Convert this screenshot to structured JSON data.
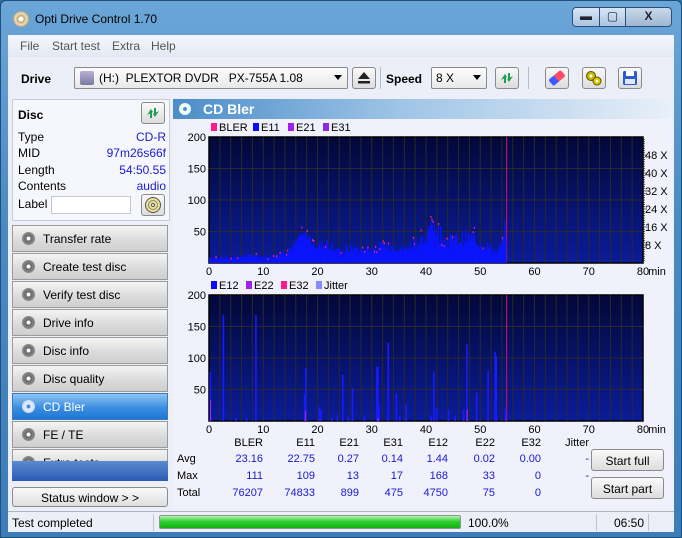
{
  "window": {
    "title": "Opti Drive Control 1.70",
    "min_glyph": "▬",
    "max_glyph": "▢",
    "close_glyph": "X"
  },
  "menu": [
    "File",
    "Start test",
    "Extra",
    "Help"
  ],
  "toolbar": {
    "drive_label": "Drive",
    "drive_value": "(H:)  PLEXTOR DVDR   PX-755A 1.08",
    "speed_label": "Speed",
    "speed_value": "8 X"
  },
  "disc": {
    "title": "Disc",
    "rows": [
      {
        "key": "Type",
        "value": "CD-R"
      },
      {
        "key": "MID",
        "value": "97m26s66f"
      },
      {
        "key": "Length",
        "value": "54:50.55"
      },
      {
        "key": "Contents",
        "value": "audio"
      }
    ],
    "label_key": "Label",
    "label_value": ""
  },
  "nav": [
    {
      "label": "Transfer rate",
      "active": false
    },
    {
      "label": "Create test disc",
      "active": false
    },
    {
      "label": "Verify test disc",
      "active": false
    },
    {
      "label": "Drive info",
      "active": false
    },
    {
      "label": "Disc info",
      "active": false
    },
    {
      "label": "Disc quality",
      "active": false
    },
    {
      "label": "CD Bler",
      "active": true
    },
    {
      "label": "FE / TE",
      "active": false
    },
    {
      "label": "Extra tests",
      "active": false
    }
  ],
  "status_window_button": "Status window > >",
  "panel": {
    "title": "CD Bler"
  },
  "chart_data": [
    {
      "type": "bar",
      "title": "",
      "legend": [
        {
          "name": "BLER",
          "color": "#ff1a8c"
        },
        {
          "name": "E11",
          "color": "#0a0aff"
        },
        {
          "name": "E21",
          "color": "#a020f0"
        },
        {
          "name": "E31",
          "color": "#8a2be2"
        }
      ],
      "legend_position": "top-left",
      "xlabel": "min",
      "xlim": [
        0,
        80
      ],
      "xticks": [
        0,
        10,
        20,
        30,
        40,
        50,
        60,
        70,
        80
      ],
      "ylim": [
        0,
        200
      ],
      "yticks": [
        50,
        100,
        150,
        200
      ],
      "y2ticks": [
        "8 X",
        "16 X",
        "24 X",
        "32 X",
        "40 X",
        "48 X"
      ],
      "y2lim": [
        0,
        56
      ],
      "grid": true,
      "disc_end_min": 54.85,
      "series_profile": {
        "name": "E11/BLER (approx. envelope)",
        "x": [
          0,
          2,
          4,
          6,
          8,
          10,
          12,
          14,
          16,
          17,
          18,
          19,
          20,
          22,
          24,
          26,
          28,
          30,
          32,
          34,
          36,
          38,
          40,
          41,
          42,
          44,
          46,
          48,
          50,
          52,
          53,
          54,
          54.8
        ],
        "values": [
          10,
          10,
          9,
          12,
          14,
          10,
          14,
          22,
          35,
          55,
          48,
          40,
          30,
          38,
          20,
          28,
          25,
          27,
          30,
          32,
          25,
          40,
          42,
          78,
          60,
          40,
          45,
          48,
          38,
          28,
          20,
          35,
          80
        ]
      }
    },
    {
      "type": "bar",
      "title": "",
      "legend": [
        {
          "name": "E12",
          "color": "#0a0aff"
        },
        {
          "name": "E22",
          "color": "#a020f0"
        },
        {
          "name": "E32",
          "color": "#ff1a8c"
        },
        {
          "name": "Jitter",
          "color": "#8888ff"
        }
      ],
      "legend_position": "top-left",
      "xlabel": "min",
      "xlim": [
        0,
        80
      ],
      "xticks": [
        0,
        10,
        20,
        30,
        40,
        50,
        60,
        70,
        80
      ],
      "ylim": [
        0,
        200
      ],
      "yticks": [
        50,
        100,
        150,
        200
      ],
      "grid": true,
      "disc_end_min": 54.85,
      "spikes": {
        "name": "E12",
        "x": [
          0.1,
          2.5,
          4.8,
          6.8,
          8.5,
          17.5,
          17.7,
          20.2,
          20.5,
          22.5,
          23.5,
          24.5,
          25.5,
          26.3,
          28.5,
          30.8,
          31.0,
          31.2,
          32.9,
          34.4,
          35.0,
          36.2,
          40.8,
          41.3,
          41.8,
          44.0,
          45.2,
          46.8,
          47.4,
          49.2,
          51.3,
          52.6,
          52.8,
          54.5
        ],
        "values": [
          78,
          168,
          5,
          5,
          168,
          42,
          84,
          22,
          18,
          6,
          10,
          73,
          8,
          52,
          8,
          86,
          86,
          25,
          124,
          44,
          8,
          26,
          8,
          78,
          20,
          18,
          8,
          18,
          122,
          45,
          80,
          110,
          103,
          20
        ]
      },
      "spikes_e22": {
        "name": "E22",
        "x": [
          0.1,
          17.6,
          31.0,
          47.4
        ],
        "values": [
          33,
          16,
          5,
          18
        ]
      }
    }
  ],
  "stats": {
    "columns": [
      "BLER",
      "E11",
      "E21",
      "E31",
      "E12",
      "E22",
      "E32",
      "Jitter"
    ],
    "rows": [
      {
        "label": "Avg",
        "values": [
          "23.16",
          "22.75",
          "0.27",
          "0.14",
          "1.44",
          "0.02",
          "0.00",
          "-"
        ]
      },
      {
        "label": "Max",
        "values": [
          "111",
          "109",
          "13",
          "17",
          "168",
          "33",
          "0",
          "-"
        ]
      },
      {
        "label": "Total",
        "values": [
          "76207",
          "74833",
          "899",
          "475",
          "4750",
          "75",
          "0",
          ""
        ]
      }
    ]
  },
  "buttons": {
    "start_full": "Start full",
    "start_part": "Start part"
  },
  "statusbar": {
    "text": "Test completed",
    "progress_percent": 100,
    "progress_text": "100.0%",
    "time": "06:50"
  }
}
